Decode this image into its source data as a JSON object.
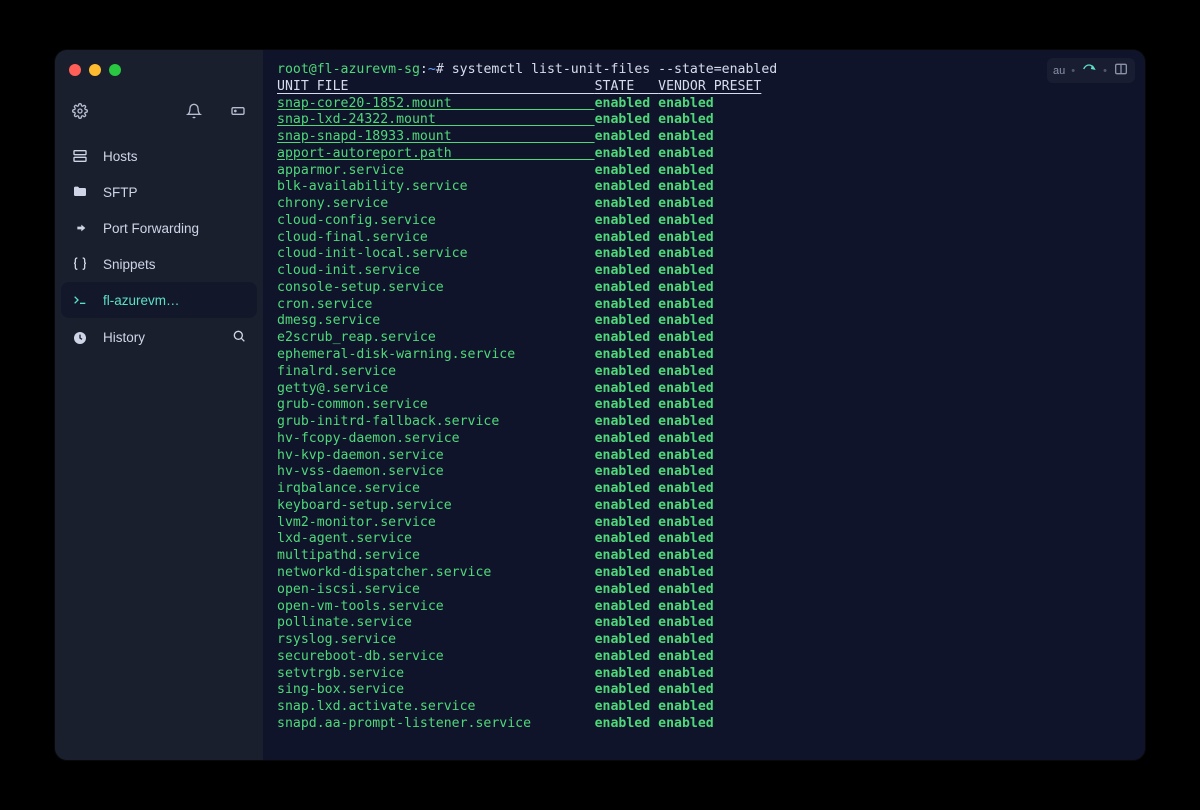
{
  "topbar": {
    "au": "au",
    "bullet": "•"
  },
  "sidebar": {
    "items": [
      {
        "label": "Hosts"
      },
      {
        "label": "SFTP"
      },
      {
        "label": "Port Forwarding"
      },
      {
        "label": "Snippets"
      },
      {
        "label": "fl-azurevm…"
      },
      {
        "label": "History"
      }
    ]
  },
  "terminal": {
    "prompt_user": "root@fl-azurevm-sg",
    "prompt_path": "~",
    "prompt_sep": "#",
    "command": "systemctl list-unit-files --state=enabled",
    "header": {
      "unit": "UNIT FILE",
      "state": "STATE",
      "preset": "VENDOR PRESET"
    },
    "linked_rows": [
      {
        "name": "snap-core20-1852.mount",
        "state": "enabled",
        "preset": "enabled"
      },
      {
        "name": "snap-lxd-24322.mount",
        "state": "enabled",
        "preset": "enabled"
      },
      {
        "name": "snap-snapd-18933.mount",
        "state": "enabled",
        "preset": "enabled"
      },
      {
        "name": "apport-autoreport.path",
        "state": "enabled",
        "preset": "enabled"
      }
    ],
    "rows": [
      {
        "name": "apparmor.service",
        "state": "enabled",
        "preset": "enabled"
      },
      {
        "name": "blk-availability.service",
        "state": "enabled",
        "preset": "enabled"
      },
      {
        "name": "chrony.service",
        "state": "enabled",
        "preset": "enabled"
      },
      {
        "name": "cloud-config.service",
        "state": "enabled",
        "preset": "enabled"
      },
      {
        "name": "cloud-final.service",
        "state": "enabled",
        "preset": "enabled"
      },
      {
        "name": "cloud-init-local.service",
        "state": "enabled",
        "preset": "enabled"
      },
      {
        "name": "cloud-init.service",
        "state": "enabled",
        "preset": "enabled"
      },
      {
        "name": "console-setup.service",
        "state": "enabled",
        "preset": "enabled"
      },
      {
        "name": "cron.service",
        "state": "enabled",
        "preset": "enabled"
      },
      {
        "name": "dmesg.service",
        "state": "enabled",
        "preset": "enabled"
      },
      {
        "name": "e2scrub_reap.service",
        "state": "enabled",
        "preset": "enabled"
      },
      {
        "name": "ephemeral-disk-warning.service",
        "state": "enabled",
        "preset": "enabled"
      },
      {
        "name": "finalrd.service",
        "state": "enabled",
        "preset": "enabled"
      },
      {
        "name": "getty@.service",
        "state": "enabled",
        "preset": "enabled"
      },
      {
        "name": "grub-common.service",
        "state": "enabled",
        "preset": "enabled"
      },
      {
        "name": "grub-initrd-fallback.service",
        "state": "enabled",
        "preset": "enabled"
      },
      {
        "name": "hv-fcopy-daemon.service",
        "state": "enabled",
        "preset": "enabled"
      },
      {
        "name": "hv-kvp-daemon.service",
        "state": "enabled",
        "preset": "enabled"
      },
      {
        "name": "hv-vss-daemon.service",
        "state": "enabled",
        "preset": "enabled"
      },
      {
        "name": "irqbalance.service",
        "state": "enabled",
        "preset": "enabled"
      },
      {
        "name": "keyboard-setup.service",
        "state": "enabled",
        "preset": "enabled"
      },
      {
        "name": "lvm2-monitor.service",
        "state": "enabled",
        "preset": "enabled"
      },
      {
        "name": "lxd-agent.service",
        "state": "enabled",
        "preset": "enabled"
      },
      {
        "name": "multipathd.service",
        "state": "enabled",
        "preset": "enabled"
      },
      {
        "name": "networkd-dispatcher.service",
        "state": "enabled",
        "preset": "enabled"
      },
      {
        "name": "open-iscsi.service",
        "state": "enabled",
        "preset": "enabled"
      },
      {
        "name": "open-vm-tools.service",
        "state": "enabled",
        "preset": "enabled"
      },
      {
        "name": "pollinate.service",
        "state": "enabled",
        "preset": "enabled"
      },
      {
        "name": "rsyslog.service",
        "state": "enabled",
        "preset": "enabled"
      },
      {
        "name": "secureboot-db.service",
        "state": "enabled",
        "preset": "enabled"
      },
      {
        "name": "setvtrgb.service",
        "state": "enabled",
        "preset": "enabled"
      },
      {
        "name": "sing-box.service",
        "state": "enabled",
        "preset": "enabled"
      },
      {
        "name": "snap.lxd.activate.service",
        "state": "enabled",
        "preset": "enabled"
      },
      {
        "name": "snapd.aa-prompt-listener.service",
        "state": "enabled",
        "preset": "enabled"
      }
    ]
  },
  "cols": {
    "unit_w": 40,
    "state_w": 8
  }
}
